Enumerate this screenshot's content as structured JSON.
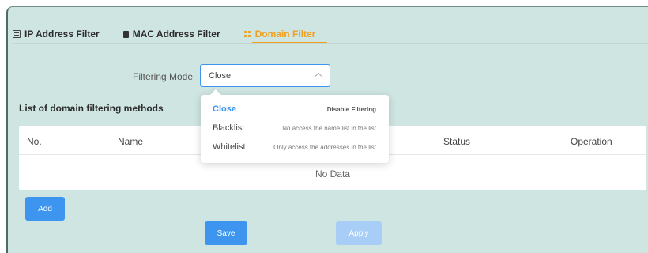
{
  "tabs": [
    {
      "label": "IP Address Filter",
      "icon": "ip-list-icon"
    },
    {
      "label": "MAC Address Filter",
      "icon": "mac-chip-icon"
    },
    {
      "label": "Domain Filter",
      "icon": "domain-grid-icon",
      "active": true
    }
  ],
  "filter": {
    "label": "Filtering Mode",
    "value": "Close"
  },
  "dropdown": {
    "options": [
      {
        "name": "Close",
        "desc": "Disable Filtering",
        "selected": true
      },
      {
        "name": "Blacklist",
        "desc": "No access the name list in the list"
      },
      {
        "name": "Whitelist",
        "desc": "Only access the addresses in the list"
      }
    ]
  },
  "section": {
    "title": "List of domain filtering methods"
  },
  "table": {
    "columns": [
      "No.",
      "Name",
      "Status",
      "Operation"
    ],
    "empty": "No Data"
  },
  "buttons": {
    "add": "Add",
    "save": "Save",
    "apply": "Apply"
  },
  "colors": {
    "accent": "#3d95f0",
    "active_tab": "#f0a020",
    "background": "#cfe5e2"
  }
}
